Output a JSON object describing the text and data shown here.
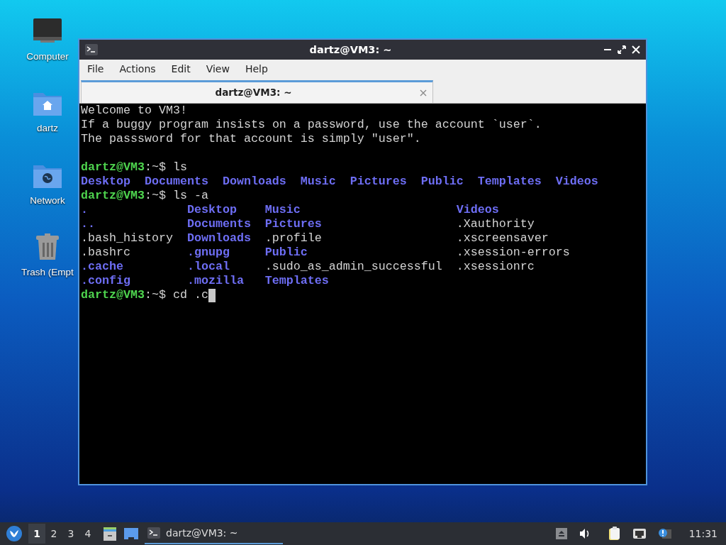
{
  "desktop_icons": [
    {
      "label": "Computer",
      "kind": "computer"
    },
    {
      "label": "dartz",
      "kind": "home"
    },
    {
      "label": "Network",
      "kind": "network"
    },
    {
      "label": "Trash (Empt",
      "kind": "trash"
    }
  ],
  "window": {
    "title": "dartz@VM3: ~",
    "menu": [
      "File",
      "Actions",
      "Edit",
      "View",
      "Help"
    ],
    "tabs": [
      {
        "label": "dartz@VM3: ~",
        "selected": true
      }
    ],
    "terminal": {
      "lines": [
        {
          "kind": "text",
          "text": "Welcome to VM3!"
        },
        {
          "kind": "text",
          "text": "If a buggy program insists on a password, use the account `user`."
        },
        {
          "kind": "text",
          "text": "The passsword for that account is simply \"user\"."
        },
        {
          "kind": "blank"
        },
        {
          "kind": "prompt",
          "prompt": "dartz@VM3",
          "text": ":~$ ls",
          "cursor": false
        },
        {
          "kind": "row",
          "items": [
            {
              "text": "Desktop",
              "dir": true
            },
            {
              "text": "Documents",
              "dir": true
            },
            {
              "text": "Downloads",
              "dir": true
            },
            {
              "text": "Music",
              "dir": true
            },
            {
              "text": "Pictures",
              "dir": true
            },
            {
              "text": "Public",
              "dir": true
            },
            {
              "text": "Templates",
              "dir": true
            },
            {
              "text": "Videos",
              "dir": true
            }
          ]
        },
        {
          "kind": "prompt",
          "prompt": "dartz@VM3",
          "text": ":~$ ls -a",
          "cursor": false
        },
        {
          "kind": "columns",
          "columns": [
            [
              {
                "text": ".",
                "dir": true
              },
              {
                "text": "..",
                "dir": true
              },
              {
                "text": ".bash_history",
                "dir": false
              },
              {
                "text": ".bashrc",
                "dir": false
              },
              {
                "text": ".cache",
                "dir": true
              },
              {
                "text": ".config",
                "dir": true
              }
            ],
            [
              {
                "text": "Desktop",
                "dir": true
              },
              {
                "text": "Documents",
                "dir": true
              },
              {
                "text": "Downloads",
                "dir": true
              },
              {
                "text": ".gnupg",
                "dir": true
              },
              {
                "text": ".local",
                "dir": true
              },
              {
                "text": ".mozilla",
                "dir": true
              }
            ],
            [
              {
                "text": "Music",
                "dir": true
              },
              {
                "text": "Pictures",
                "dir": true
              },
              {
                "text": ".profile",
                "dir": false
              },
              {
                "text": "Public",
                "dir": true
              },
              {
                "text": ".sudo_as_admin_successful",
                "dir": false
              },
              {
                "text": "Templates",
                "dir": true
              }
            ],
            [
              {
                "text": "Videos",
                "dir": true
              },
              {
                "text": ".Xauthority",
                "dir": false
              },
              {
                "text": ".xscreensaver",
                "dir": false
              },
              {
                "text": ".xsession-errors",
                "dir": false
              },
              {
                "text": ".xsessionrc",
                "dir": false
              }
            ]
          ]
        },
        {
          "kind": "prompt",
          "prompt": "dartz@VM3",
          "text": ":~$ cd .c",
          "cursor": true
        }
      ]
    }
  },
  "taskbar": {
    "workspaces": [
      {
        "label": "1",
        "selected": true
      },
      {
        "label": "2",
        "selected": false
      },
      {
        "label": "3",
        "selected": false
      },
      {
        "label": "4",
        "selected": false
      }
    ],
    "tasks": [
      {
        "label": "dartz@VM3: ~",
        "selected": true
      }
    ],
    "clock": "11:31"
  }
}
